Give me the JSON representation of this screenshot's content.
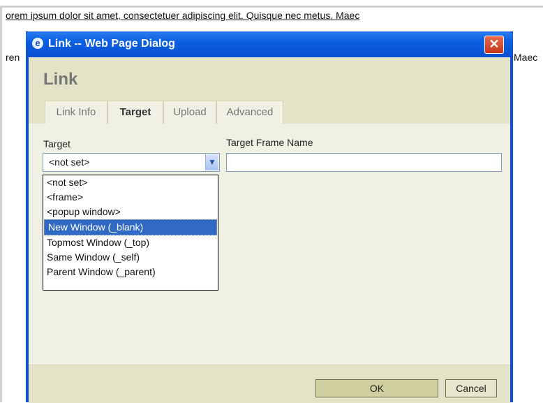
{
  "background": {
    "line1": "orem ipsum dolor sit amet, consectetuer adipiscing elit. Quisque nec metus. Maec",
    "line2_left": "ren",
    "line2_right": "Maec"
  },
  "dialog": {
    "title": "Link -- Web Page Dialog",
    "close_label": "✕",
    "heading": "Link",
    "tabs": [
      {
        "label": "Link Info"
      },
      {
        "label": "Target"
      },
      {
        "label": "Upload"
      },
      {
        "label": "Advanced"
      }
    ],
    "target_label": "Target",
    "target_value": "<not set>",
    "frame_name_label": "Target Frame Name",
    "frame_name_value": "",
    "options": [
      "<not set>",
      "<frame>",
      "<popup window>",
      "New Window (_blank)",
      "Topmost Window (_top)",
      "Same Window (_self)",
      "Parent Window (_parent)"
    ],
    "selected_option": "New Window (_blank)",
    "ok_label": "OK",
    "cancel_label": "Cancel"
  },
  "colors": {
    "titlebar": "#0a5fe0",
    "dialog_bg": "#f1f1e3",
    "header_bg": "#e3e3c7",
    "selection": "#316ac5"
  }
}
